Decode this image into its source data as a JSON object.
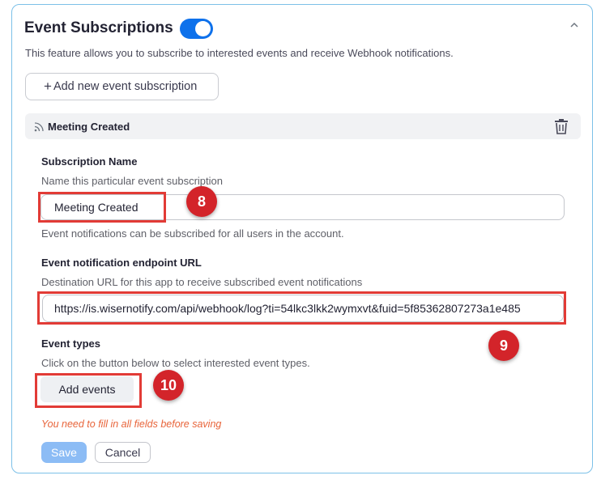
{
  "section": {
    "title": "Event Subscriptions",
    "toggle_on": true,
    "description": "This feature allows you to subscribe to interested events and receive Webhook notifications.",
    "add_subscription_label": "Add new event subscription",
    "add_icon": "+"
  },
  "subscription": {
    "header_label": "Meeting Created",
    "name_label": "Subscription Name",
    "name_help": "Name this particular event subscription",
    "name_value": "Meeting Created",
    "scope_note": "Event notifications can be subscribed for all users in the account.",
    "url_label": "Event notification endpoint URL",
    "url_help": "Destination URL for this app to receive subscribed event notifications",
    "url_value": "https://is.wisernotify.com/api/webhook/log?ti=54lkc3lkk2wymxvt&fuid=5f85362807273a1e485",
    "event_types_label": "Event types",
    "event_types_help": "Click on the button below to select interested event types.",
    "add_events_label": "Add events"
  },
  "form": {
    "error_text": "You need to fill in all fields before saving",
    "save_label": "Save",
    "cancel_label": "Cancel"
  },
  "annotations": {
    "step_8": "8",
    "step_9": "9",
    "step_10": "10",
    "highlight_color": "#e23b36"
  },
  "colors": {
    "accent": "#0e71eb",
    "save_disabled": "#8cbcf5",
    "error": "#e8643a",
    "border": "#7cc0e8"
  },
  "icons": {
    "collapse": "chevron-up-icon",
    "feed": "rss-icon",
    "delete": "trash-icon"
  }
}
